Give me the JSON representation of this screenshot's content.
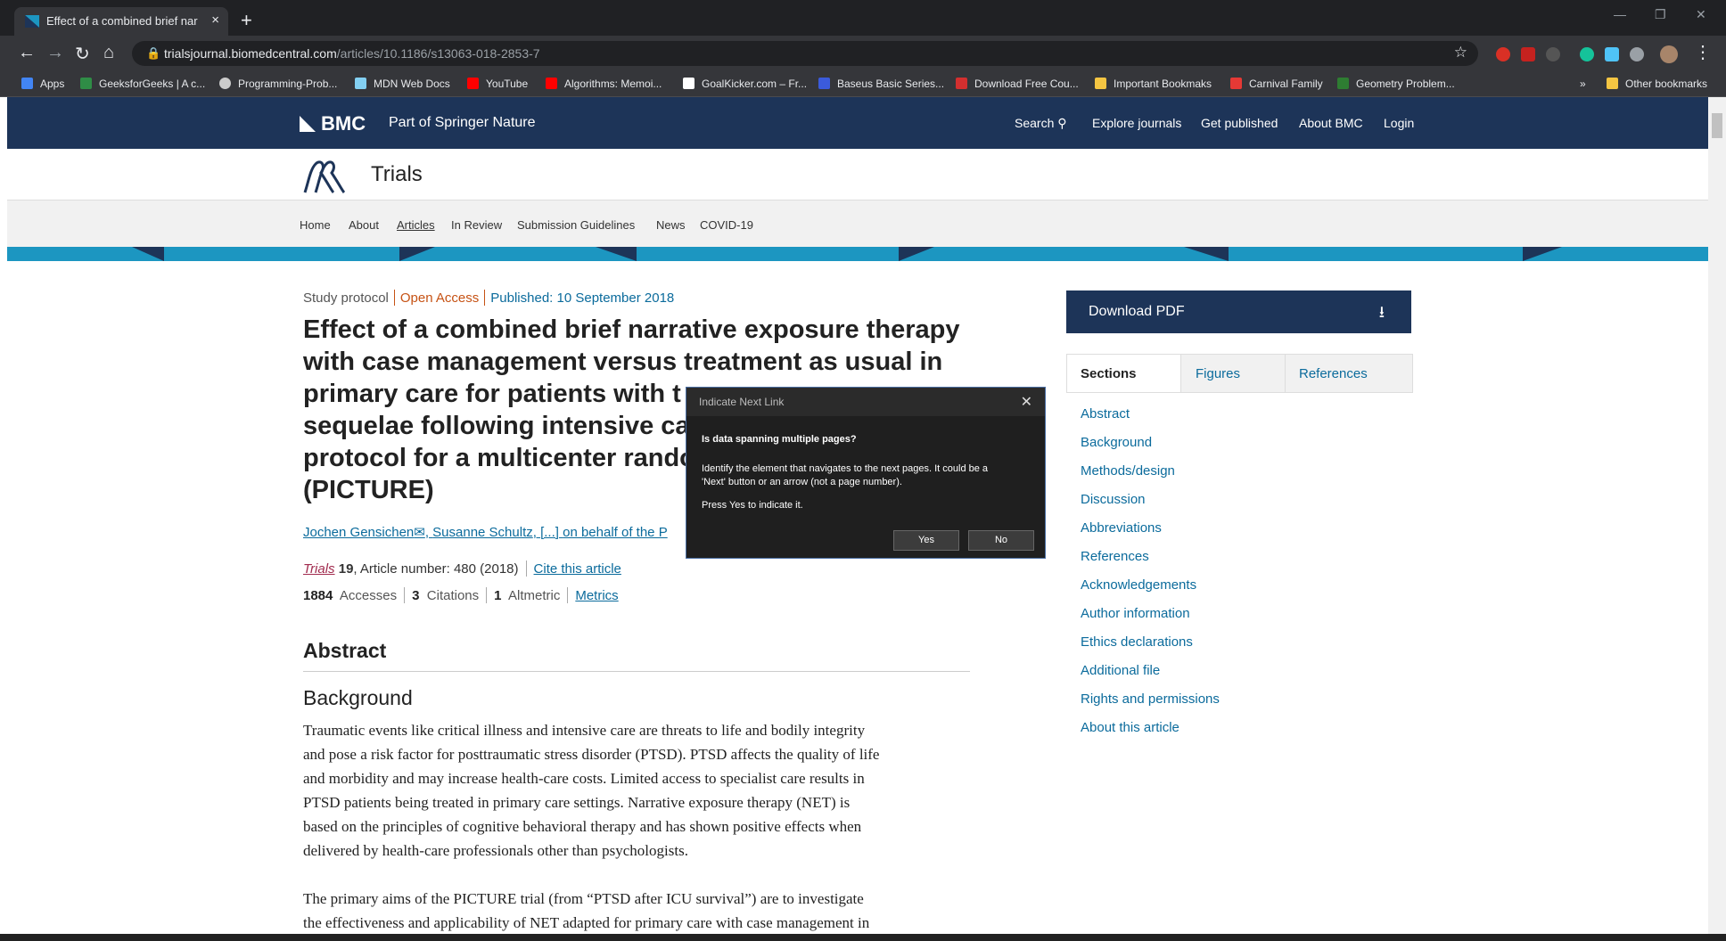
{
  "browser": {
    "tab_title": "Effect of a combined brief narrative exposure",
    "tab_close": "×",
    "new_tab": "+",
    "url_domain": "trialsjournal.biomedcentral.com",
    "url_path": "/articles/10.1186/s13063-018-2853-7",
    "bookmarks": [
      "Apps",
      "GeeksforGeeks | A c...",
      "Programming-Prob...",
      "MDN Web Docs",
      "YouTube",
      "Algorithms: Memoi...",
      "GoalKicker.com – Fr...",
      "Baseus Basic Series...",
      "Download Free Cou...",
      "Important Bookmaks",
      "Carnival Family",
      "Geometry Problem..."
    ],
    "bookmarks_more": "»",
    "other_bookmarks": "Other bookmarks"
  },
  "header": {
    "brand": "BMC",
    "springer": "Part of Springer Nature",
    "nav": [
      "Search",
      "Explore journals",
      "Get published",
      "About BMC",
      "Login"
    ]
  },
  "journal": {
    "name": "Trials",
    "subnav": [
      "Home",
      "About",
      "Articles",
      "In Review",
      "Submission Guidelines",
      "News",
      "COVID-19"
    ]
  },
  "article": {
    "type": "Study protocol",
    "access": "Open Access",
    "published": "Published: 10 September 2018",
    "title": "Effect of a combined brief narrative exposure therapy with case management versus treatment as usual in primary care for patients with t sequelae following intensive ca protocol for a multicenter rando (PICTURE)",
    "title_lines": [
      "Effect of a combined brief narrative exposure therapy",
      "with case management versus treatment as usual in",
      "primary care for patients with t",
      "sequelae following intensive ca",
      "protocol for a multicenter rando",
      "(PICTURE)"
    ],
    "author1": "Jochen Gensichen",
    "author2": "Susanne Schultz",
    "author_etal": "[...]",
    "author_group": "on behalf of the P",
    "journal_ref": "Trials",
    "volume": "19",
    "article_number": ", Article number: 480 (2018)",
    "cite_link": "Cite this article",
    "accesses_count": "1884",
    "accesses_label": "Accesses",
    "citations_count": "3",
    "citations_label": "Citations",
    "altmetric_count": "1",
    "altmetric_label": "Altmetric",
    "metrics_link": "Metrics",
    "abstract_heading": "Abstract",
    "background_heading": "Background",
    "para1_lines": [
      "Traumatic events like critical illness and intensive care are threats to life and bodily integrity",
      "and pose a risk factor for posttraumatic stress disorder (PTSD). PTSD affects the quality of life",
      "and morbidity and may increase health-care costs. Limited access to specialist care results in",
      "PTSD patients being treated in primary care settings. Narrative exposure therapy (NET) is",
      "based on the principles of cognitive behavioral therapy and has shown positive effects when",
      "delivered by health-care professionals other than psychologists."
    ],
    "para2_lines": [
      "The primary aims of the PICTURE trial (from “PTSD after ICU survival”) are to investigate",
      "the effectiveness and applicability of NET adapted for primary care with case management in"
    ]
  },
  "sidebar": {
    "download_pdf": "Download PDF",
    "tabs": [
      "Sections",
      "Figures",
      "References"
    ],
    "sections": [
      "Abstract",
      "Background",
      "Methods/design",
      "Discussion",
      "Abbreviations",
      "References",
      "Acknowledgements",
      "Author information",
      "Ethics declarations",
      "Additional file",
      "Rights and permissions",
      "About this article"
    ]
  },
  "dialog": {
    "title": "Indicate Next Link",
    "question": "Is data spanning multiple pages?",
    "desc_line1": "Identify the element that navigates to the next pages. It could be a",
    "desc_line2": "'Next' button or an arrow (not a page number).",
    "instruction": "Press Yes to indicate it.",
    "yes": "Yes",
    "no": "No"
  },
  "colors": {
    "bmc_navy": "#1d3458",
    "accent_blue": "#1c96c1",
    "link": "#0b6b9c",
    "open_access": "#c65214"
  }
}
